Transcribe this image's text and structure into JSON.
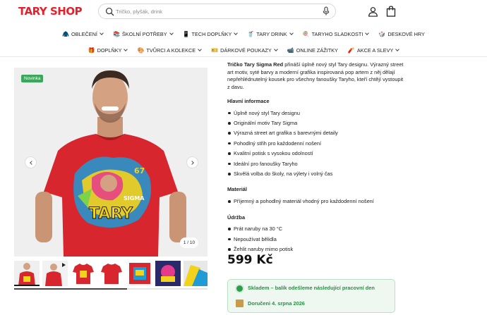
{
  "header": {
    "logo": "TARY SHOP",
    "search_placeholder": "Tričko, plyšák, drink"
  },
  "nav": {
    "row1": [
      {
        "emoji": "🧥",
        "label": "OBLEČENÍ",
        "chevron": true
      },
      {
        "emoji": "📚",
        "label": "ŠKOLNÍ POTŘEBY",
        "chevron": true
      },
      {
        "emoji": "📱",
        "label": "TECH DOPLŇKY",
        "chevron": true
      },
      {
        "emoji": "🥤",
        "label": "TARY DRINK",
        "chevron": true
      },
      {
        "emoji": "🍭",
        "label": "TARYHO SLADKOSTI",
        "chevron": true
      },
      {
        "emoji": "🎲",
        "label": "DESKOVÉ HRY",
        "chevron": false
      }
    ],
    "row2": [
      {
        "emoji": "🎁",
        "label": "DOPLŇKY",
        "chevron": true
      },
      {
        "emoji": "🎨",
        "label": "TVŮRCI A KOLEKCE",
        "chevron": true
      },
      {
        "emoji": "🎫",
        "label": "DÁRKOVÉ POUKAZY",
        "chevron": true
      },
      {
        "emoji": "📹",
        "label": "ONLINE ZÁŽITKY",
        "chevron": false
      },
      {
        "emoji": "🧨",
        "label": "AKCE A SLEVY",
        "chevron": true
      }
    ]
  },
  "gallery": {
    "badge": "Novinka",
    "counter": "1 / 10",
    "shirt_text": "TARY",
    "shirt_text_small": "SIGMA",
    "shirt_number": "67"
  },
  "product": {
    "intro_bold": "Tričko Tary Sigma Red",
    "intro_rest": " přináší úplně nový styl Tary designu. Výrazný street art motiv, syté barvy a moderní grafika inspirovaná pop artem z něj dělají nepřehlédnutelný kousek pro všechny fanoušky Taryho, kteří chtějí vystoupit z davu.",
    "sections": [
      {
        "title": "Hlavní informace",
        "items": [
          "Úplně nový styl Tary designu",
          "Originální motiv Tary Sigma",
          "Výrazná street art grafika s barevnými detaily",
          "Pohodlný střih pro každodenní nošení",
          "Kvalitní potisk s vysokou odolností",
          "Ideální pro fanoušky Taryho",
          "Skvělá volba do školy, na výlety i volný čas"
        ]
      },
      {
        "title": "Materiál",
        "items": [
          "Příjemný a pohodlný materiál vhodný pro každodenní nošení"
        ]
      },
      {
        "title": "Údržba",
        "items": [
          "Prát naruby na 30 °C",
          "Nepoužívat bělidla",
          "Žehlit naruby mimo potisk"
        ]
      }
    ],
    "price": "599 Kč",
    "stock": "Skladem – balík odešleme následující pracovní den",
    "delivery": "Doručeni 4. srpna 2026"
  },
  "colors": {
    "brand": "#e3222e",
    "shirt": "#d8262e",
    "stock_green": "#2e8b47",
    "badge_green": "#3aa85a"
  }
}
